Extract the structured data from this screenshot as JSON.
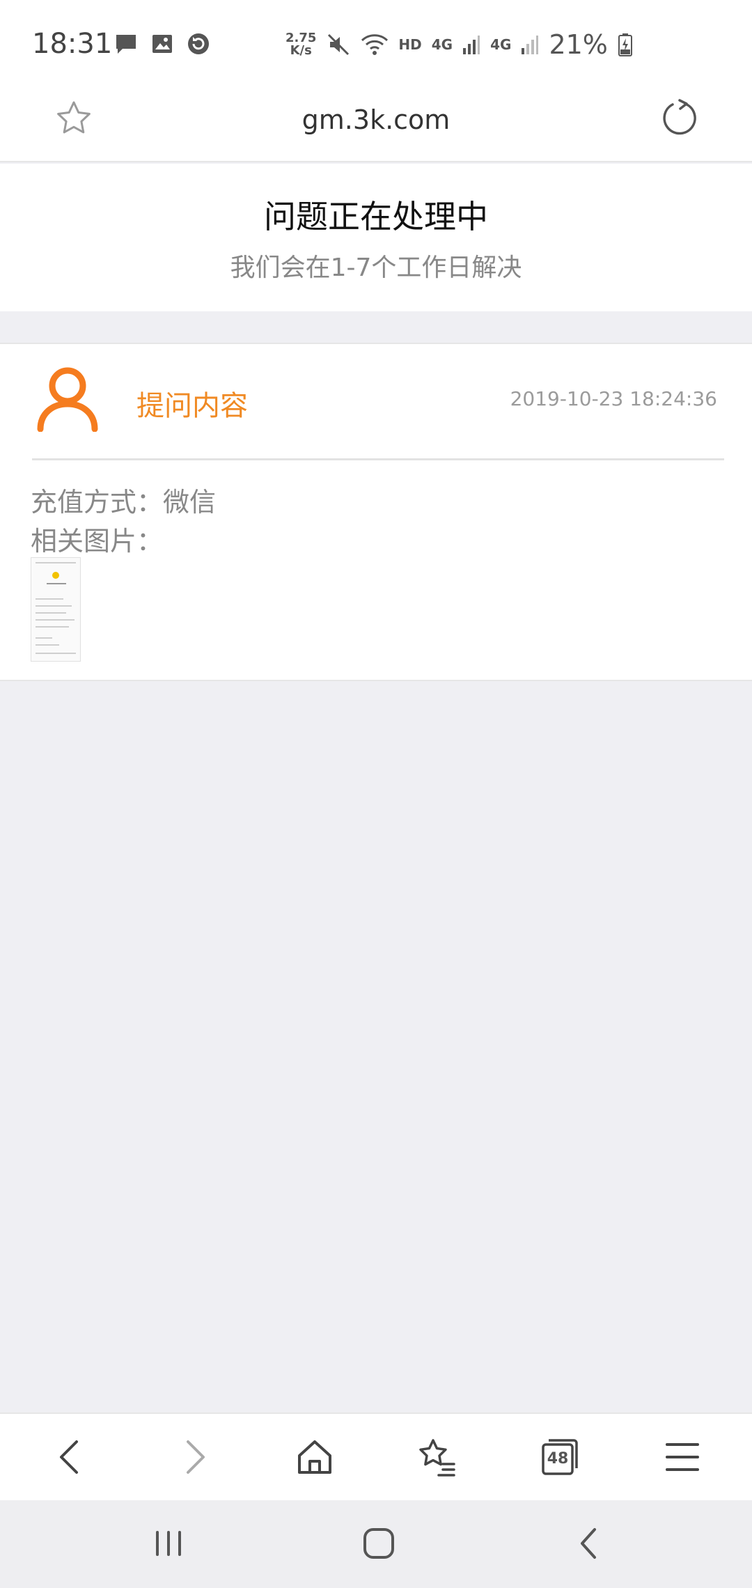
{
  "status_bar": {
    "time": "18:31",
    "net_speed_value": "2.75",
    "net_speed_unit": "K/s",
    "hd_label": "HD",
    "network_1": "4G",
    "network_2": "4G",
    "battery": "21%",
    "icons": [
      "message-icon",
      "image-icon",
      "sync-icon",
      "mute-icon",
      "wifi-icon",
      "signal-icon",
      "battery-charging-icon"
    ]
  },
  "browser": {
    "url": "gm.3k.com",
    "icons": [
      "star-icon",
      "reload-icon"
    ]
  },
  "processing": {
    "title": "问题正在处理中",
    "subtitle": "我们会在1-7个工作日解决"
  },
  "question": {
    "label": "提问内容",
    "timestamp": "2019-10-23 18:24:36",
    "payment_method": "充值方式：微信",
    "related_images": "相关图片："
  },
  "toolbar": {
    "tab_count": "48",
    "icons": [
      "back-icon",
      "forward-icon",
      "home-icon",
      "bookmarks-icon",
      "tabs-icon",
      "menu-icon"
    ]
  },
  "colors": {
    "accent": "#f08a24",
    "avatar": "#f57c1f",
    "background": "#efeff3"
  }
}
